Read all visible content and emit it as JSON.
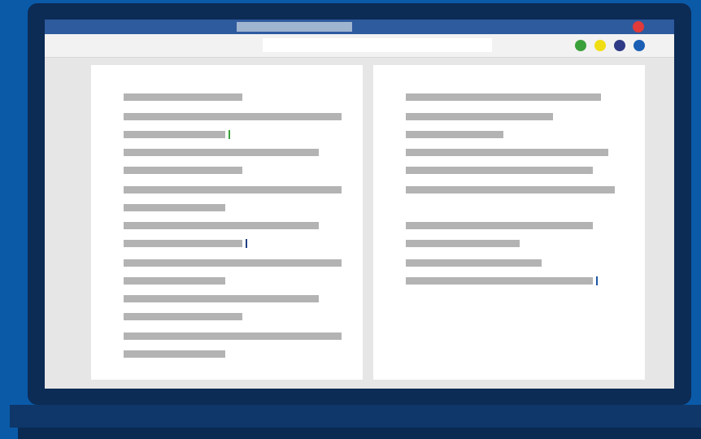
{
  "colors": {
    "background": "#0a5aa8",
    "bezel": "#0c2b55",
    "titlebar": "#2e5a9e",
    "close_dot": "#e03a3a",
    "text_lines": "#b3b3b3",
    "cursor_green": "#3aa03a",
    "cursor_blue": "#1e3f86",
    "cursor_blue_right": "#1a55a6"
  },
  "toolbar": {
    "dots": [
      {
        "name": "green-dot",
        "color": "#3aa03a"
      },
      {
        "name": "yellow-dot",
        "color": "#f0de14"
      },
      {
        "name": "navy-dot",
        "color": "#2f3a86"
      },
      {
        "name": "blue-dot",
        "color": "#1a5fb4"
      }
    ]
  },
  "icons": {
    "close": "close-icon",
    "text_cursor": "text-cursor-icon"
  }
}
